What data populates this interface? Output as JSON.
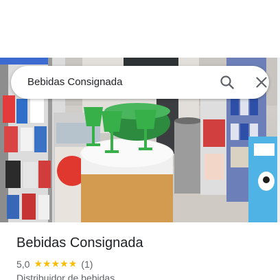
{
  "search": {
    "query": "Bebidas Consignada"
  },
  "photo": {
    "alt": "Foto de Bebidas Consignada"
  },
  "place": {
    "name": "Bebidas Consignada",
    "rating": "5,0",
    "star_count": 5,
    "reviews": "(1)",
    "category": "Distribuidor de bebidas"
  },
  "colors": {
    "star": "#fbbc04",
    "title": "#202124",
    "secondary": "#5f6368"
  },
  "icons": {
    "search": "search-icon",
    "close": "close-icon"
  }
}
